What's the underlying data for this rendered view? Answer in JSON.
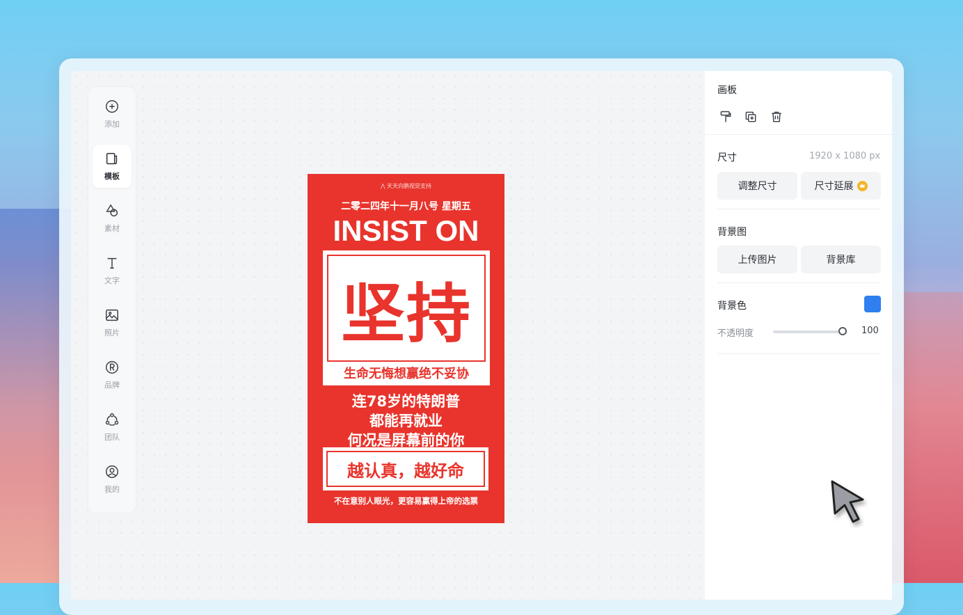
{
  "tools": [
    {
      "icon": "add-icon",
      "label": "添加"
    },
    {
      "icon": "template-icon",
      "label": "模板"
    },
    {
      "icon": "shapes-icon",
      "label": "素材"
    },
    {
      "icon": "text-icon",
      "label": "文字"
    },
    {
      "icon": "photo-icon",
      "label": "照片"
    },
    {
      "icon": "brand-icon",
      "label": "品牌"
    },
    {
      "icon": "team-icon",
      "label": "团队"
    },
    {
      "icon": "user-icon",
      "label": "我的"
    }
  ],
  "poster": {
    "credit": "天天向鹏视觉支持",
    "date": "二零二四年十一月八号 星期五",
    "headline": "INSIST ON",
    "big_chars": "坚持",
    "box_sub": "生命无悔想赢绝不妥协",
    "line1": "连78岁的特朗普",
    "line2": "都能再就业",
    "line3": "何况是屏幕前的你",
    "slogan": "越认真，越好命",
    "footer": "不在意别人眼光，更容易赢得上帝的选票",
    "bg_color": "#e8342c"
  },
  "panel": {
    "section_title": "画板",
    "size_label": "尺寸",
    "size_value": "1920 x 1080 px",
    "resize_btn": "调整尺寸",
    "extend_btn": "尺寸延展",
    "bg_image_label": "背景图",
    "upload_btn": "上传图片",
    "bg_library_btn": "背景库",
    "bg_color_label": "背景色",
    "bg_color_value": "#2f7ff0",
    "opacity_label": "不透明度",
    "opacity_value": "100"
  }
}
